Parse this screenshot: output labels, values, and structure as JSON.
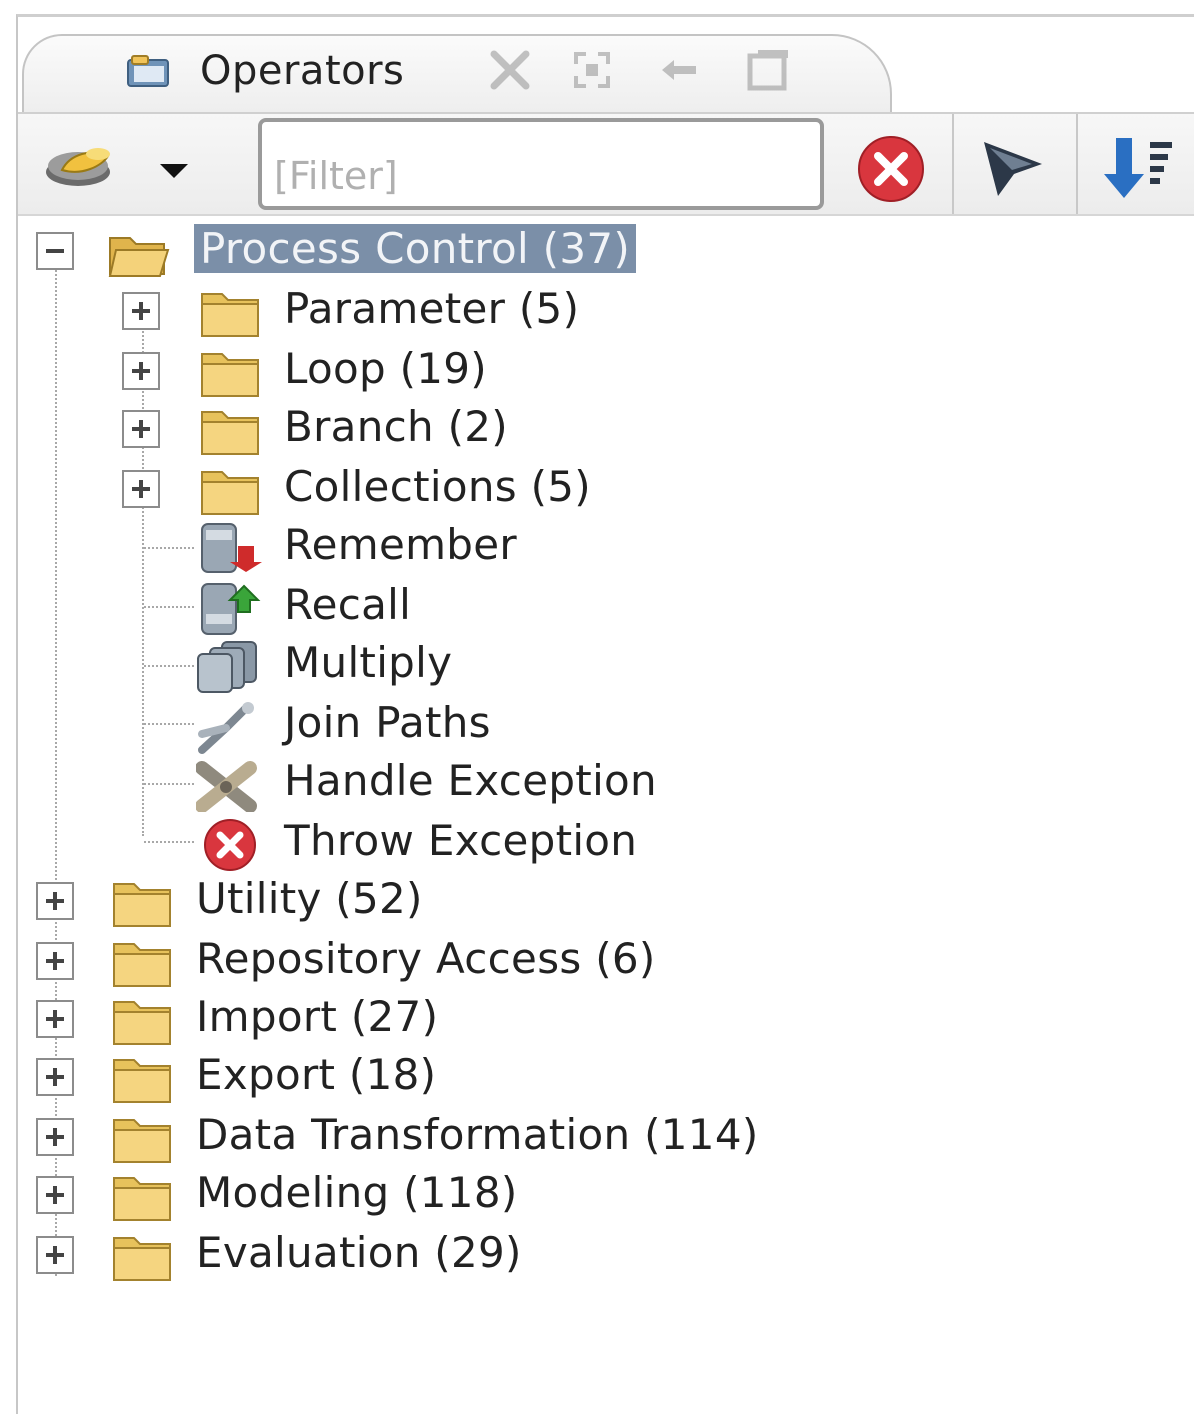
{
  "panel": {
    "title": "Operators",
    "icons": {
      "title": "operators-panel-icon",
      "actions": [
        "maximize-icon",
        "restore-icon",
        "pin-icon",
        "detach-icon"
      ]
    }
  },
  "toolbar": {
    "new_operator_icon": "new-operator-icon",
    "dropdown_icon": "chevron-down-icon",
    "filter_placeholder": "[Filter]",
    "clear_filter_icon": "clear-filter-icon",
    "funnel_icon": "funnel-icon",
    "sort_icon": "sort-icon"
  },
  "tree": {
    "root": {
      "label": "Process Control (37)",
      "expanded": true,
      "selected": true,
      "children": [
        {
          "label": "Parameter (5)",
          "type": "folder",
          "expandable": true
        },
        {
          "label": "Loop (19)",
          "type": "folder",
          "expandable": true
        },
        {
          "label": "Branch (2)",
          "type": "folder",
          "expandable": true
        },
        {
          "label": "Collections (5)",
          "type": "folder",
          "expandable": true
        },
        {
          "label": "Remember",
          "type": "operator",
          "icon": "remember-icon"
        },
        {
          "label": "Recall",
          "type": "operator",
          "icon": "recall-icon"
        },
        {
          "label": "Multiply",
          "type": "operator",
          "icon": "multiply-icon"
        },
        {
          "label": "Join Paths",
          "type": "operator",
          "icon": "join-paths-icon"
        },
        {
          "label": "Handle Exception",
          "type": "operator",
          "icon": "handle-exception-icon"
        },
        {
          "label": "Throw Exception",
          "type": "operator",
          "icon": "throw-exception-icon"
        }
      ]
    },
    "top_level": [
      {
        "label": "Utility (52)"
      },
      {
        "label": "Repository Access (6)"
      },
      {
        "label": "Import (27)"
      },
      {
        "label": "Export (18)"
      },
      {
        "label": "Data Transformation (114)"
      },
      {
        "label": "Modeling (118)"
      },
      {
        "label": "Evaluation (29)"
      }
    ]
  },
  "colors": {
    "selection": "#7b8fa8",
    "folder": "#e8c25a",
    "error_red": "#d9363e"
  }
}
